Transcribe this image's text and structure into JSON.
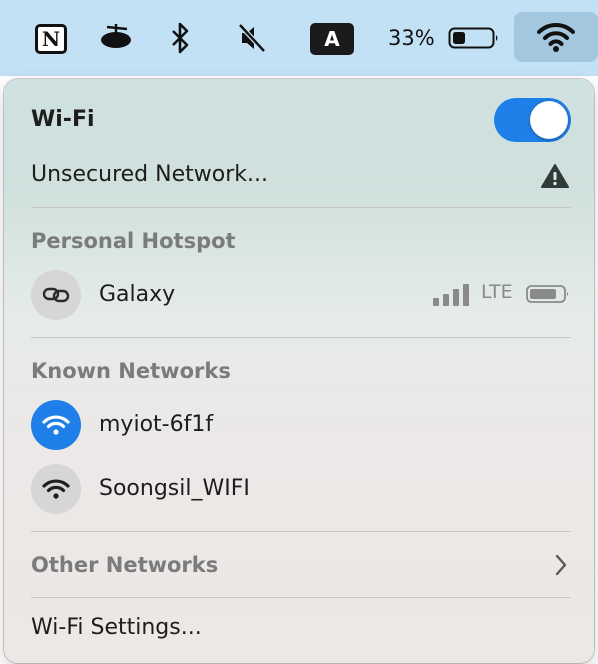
{
  "menubar": {
    "notion_letter": "N",
    "input_source_letter": "A",
    "battery_percent": "33%",
    "battery_level": 0.33,
    "icons": [
      "notion-icon",
      "bowl-icon",
      "bluetooth-icon",
      "mute-icon",
      "input-source-icon",
      "battery-icon",
      "wifi-icon"
    ]
  },
  "wifi_panel": {
    "title": "Wi-Fi",
    "wifi_enabled": true,
    "current_network": "Unsecured Network...",
    "personal_hotspot": {
      "header": "Personal Hotspot",
      "devices": [
        {
          "name": "Galaxy",
          "network_type": "LTE",
          "signal_bars": 4,
          "icon": "link-icon"
        }
      ]
    },
    "known_networks": {
      "header": "Known Networks",
      "items": [
        {
          "name": "myiot-6f1f",
          "connected": true,
          "icon": "wifi-icon"
        },
        {
          "name": "Soongsil_WIFI",
          "connected": false,
          "icon": "wifi-icon"
        }
      ]
    },
    "other_networks": {
      "label": "Other Networks"
    },
    "settings_label": "Wi-Fi Settings..."
  },
  "colors": {
    "menubar_bg": "#c3e1f4",
    "accent_blue": "#1f7fe8",
    "section_header": "#7a7b7c"
  }
}
